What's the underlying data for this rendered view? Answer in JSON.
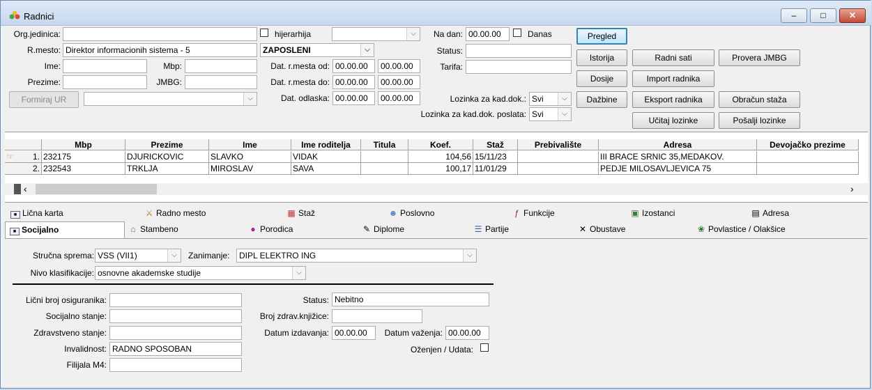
{
  "window": {
    "title": "Radnici",
    "btn_min": "–",
    "btn_max": "□",
    "btn_close": "✕"
  },
  "filters": {
    "org_jedinica_label": "Org.jedinica:",
    "org_jedinica_value": "",
    "hijerarhija_label": "hijerarhija",
    "hijerarhija_combo": "",
    "rmesto_label": "R.mesto:",
    "rmesto_value": "Direktor informacionih sistema -    5",
    "zaposleni_combo": "ZAPOSLENI",
    "ime_label": "Ime:",
    "ime_value": "",
    "mbp_label": "Mbp:",
    "mbp_value": "",
    "prezime_label": "Prezime:",
    "prezime_value": "",
    "jmbg_label": "JMBG:",
    "jmbg_value": "",
    "dat_rmesta_od_label": "Dat. r.mesta od:",
    "dat_rmesta_od_from": "00.00.00",
    "dat_rmesta_od_to": "00.00.00",
    "dat_rmesta_do_label": "Dat. r.mesta do:",
    "dat_rmesta_do_from": "00.00.00",
    "dat_rmesta_do_to": "00.00.00",
    "dat_odlaska_label": "Dat. odlaska:",
    "dat_odlaska_from": "00.00.00",
    "dat_odlaska_to": "00.00.00",
    "formiraj_ur": "Formiraj UR",
    "ur_combo": "",
    "na_dan_label": "Na dan:",
    "na_dan_value": "00.00.00",
    "danas_label": "Danas",
    "status_label": "Status:",
    "status_value": "",
    "tarifa_label": "Tarifa:",
    "tarifa_value": "",
    "lozinka_label": "Lozinka za kad.dok.:",
    "lozinka_value": "Svi",
    "lozinka_poslata_label": "Lozinka za kad.dok. poslata:",
    "lozinka_poslata_value": "Svi"
  },
  "actions": {
    "pregled": "Pregled",
    "istorija": "Istorija",
    "radni_sati": "Radni sati",
    "provera_jmbg": "Provera JMBG",
    "dosije": "Dosije",
    "import_radnika": "Import radnika",
    "dazbine": "Dažbine",
    "eksport_radnika": "Eksport radnika",
    "obracun_staza": "Obračun staža",
    "ucitaj_lozinke": "Učitaj lozinke",
    "posalji_lozinke": "Pošalji lozinke"
  },
  "grid": {
    "columns": [
      "Mbp",
      "Prezime",
      "Ime",
      "Ime roditelja",
      "Titula",
      "Koef.",
      "Staž",
      "Prebivalište",
      "Adresa",
      "Devojačko prezime"
    ],
    "rows": [
      {
        "n": "1.",
        "mbp": "232175",
        "prezime": "DJURICKOVIC",
        "ime": "SLAVKO",
        "roditelj": "VIDAK",
        "titula": "",
        "koef": "104,56",
        "staz": "15/11/23",
        "prebivaliste": "",
        "adresa": "III BRACE SRNIC 35,MEDAKOV.",
        "devojacko": ""
      },
      {
        "n": "2.",
        "mbp": "232543",
        "prezime": "TRKLJA",
        "ime": "MIROSLAV",
        "roditelj": "SAVA",
        "titula": "",
        "koef": "100,17",
        "staz": "11/01/29",
        "prebivaliste": "",
        "adresa": "PEDJE MILOSAVLJEVICA 75",
        "devojacko": ""
      }
    ],
    "scroll_left": "‹",
    "scroll_right": "›"
  },
  "tabs_row1": [
    "Lična karta",
    "Radno mesto",
    "Staž",
    "Poslovno",
    "Funkcije",
    "Izostanci",
    "Adresa"
  ],
  "tabs_row2": [
    "Socijalno",
    "Stambeno",
    "Porodica",
    "Diplome",
    "Partije",
    "Obustave",
    "Povlastice / Olakšice"
  ],
  "socijalno": {
    "strucna_sprema_label": "Stručna sprema:",
    "strucna_sprema_value": "VSS (VII1)",
    "zanimanje_label": "Zanimanje:",
    "zanimanje_value": "DIPL ELEKTRO ING",
    "nivo_label": "Nivo klasifikacije:",
    "nivo_value": "osnovne akademske studije",
    "licni_broj_label": "Lični broj osiguranika:",
    "licni_broj_value": "",
    "socijalno_stanje_label": "Socijalno stanje:",
    "socijalno_stanje_value": "",
    "zdravstveno_stanje_label": "Zdravstveno stanje:",
    "zdravstveno_stanje_value": "",
    "invalidnost_label": "Invalidnost:",
    "invalidnost_value": "RADNO SPOSOBAN",
    "filijala_label": "Filijala M4:",
    "filijala_value": "",
    "status_label": "Status:",
    "status_value": "Nebitno",
    "broj_zdrav_label": "Broj zdrav.knjižice:",
    "broj_zdrav_value": "",
    "datum_izdavanja_label": "Datum izdavanja:",
    "datum_izdavanja_value": "00.00.00",
    "datum_vazenja_label": "Datum važenja:",
    "datum_vazenja_value": "00.00.00",
    "ozenjen_label": "Oženjen / Udata:"
  }
}
